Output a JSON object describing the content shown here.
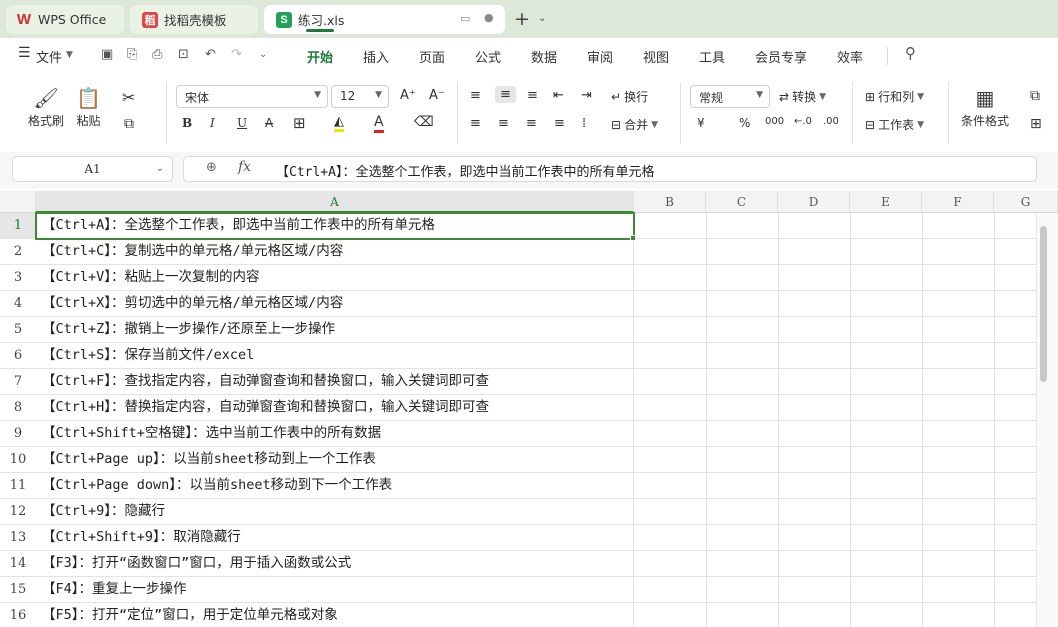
{
  "tabs": [
    {
      "logo": "W",
      "label": "WPS Office"
    },
    {
      "logo": "稻",
      "label": "找稻壳模板"
    },
    {
      "logo": "S",
      "label": "练习.xls"
    }
  ],
  "menu": [
    "文件",
    "开始",
    "插入",
    "页面",
    "公式",
    "数据",
    "审阅",
    "视图",
    "工具",
    "会员专享",
    "效率"
  ],
  "ribbon": {
    "format_painter": "格式刷",
    "paste": "粘贴",
    "font_name": "宋体",
    "font_size": "12",
    "wrap": "换行",
    "merge": "合并",
    "number_format": "常规",
    "convert": "转换",
    "rows_cols": "行和列",
    "worksheet": "工作表",
    "cond_format": "条件格式",
    "bold": "B",
    "italic": "I",
    "underline": "U",
    "strike": "A",
    "font_color_letter": "A",
    "grow": "A⁺",
    "shrink": "A⁻",
    "currency": "¥",
    "percent": "%",
    "thousands": "000",
    "dec_inc": "←.0",
    "dec_dec": ".00"
  },
  "namebox": "A1",
  "formula": "【Ctrl+A】：全选整个工作表，即选中当前工作表中的所有单元格",
  "columns": [
    "A",
    "B",
    "C",
    "D",
    "E",
    "F",
    "G"
  ],
  "rows": [
    {
      "num": "1",
      "a": "【Ctrl+A】：全选整个工作表，即选中当前工作表中的所有单元格"
    },
    {
      "num": "2",
      "a": "【Ctrl+C】：复制选中的单元格/单元格区域/内容"
    },
    {
      "num": "3",
      "a": "【Ctrl+V】：粘贴上一次复制的内容"
    },
    {
      "num": "4",
      "a": "【Ctrl+X】：剪切选中的单元格/单元格区域/内容"
    },
    {
      "num": "5",
      "a": "【Ctrl+Z】：撤销上一步操作/还原至上一步操作"
    },
    {
      "num": "6",
      "a": "【Ctrl+S】：保存当前文件/excel"
    },
    {
      "num": "7",
      "a": "【Ctrl+F】：查找指定内容，自动弹窗查询和替换窗口，输入关键词即可查"
    },
    {
      "num": "8",
      "a": "【Ctrl+H】：替换指定内容，自动弹窗查询和替换窗口，输入关键词即可查"
    },
    {
      "num": "9",
      "a": "【Ctrl+Shift+空格键】：选中当前工作表中的所有数据"
    },
    {
      "num": "10",
      "a": "【Ctrl+Page up】：以当前sheet移动到上一个工作表"
    },
    {
      "num": "11",
      "a": "【Ctrl+Page down】：以当前sheet移动到下一个工作表"
    },
    {
      "num": "12",
      "a": "【Ctrl+9】：隐藏行"
    },
    {
      "num": "13",
      "a": "【Ctrl+Shift+9】：取消隐藏行"
    },
    {
      "num": "14",
      "a": "【F3】：打开“函数窗口”窗口，用于插入函数或公式"
    },
    {
      "num": "15",
      "a": "【F4】：重复上一步操作"
    },
    {
      "num": "16",
      "a": "【F5】：打开“定位”窗口，用于定位单元格或对象"
    }
  ]
}
